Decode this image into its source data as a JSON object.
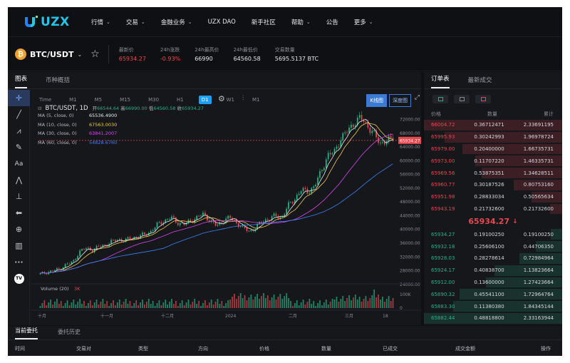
{
  "nav": {
    "logo_text": "UZX",
    "items": [
      {
        "label": "行情",
        "chevron": true
      },
      {
        "label": "交易",
        "chevron": true
      },
      {
        "label": "金融业务",
        "chevron": true
      },
      {
        "label": "UZX DAO",
        "chevron": false
      },
      {
        "label": "新手社区",
        "chevron": false
      },
      {
        "label": "帮助",
        "chevron": true
      },
      {
        "label": "公告",
        "chevron": false
      },
      {
        "label": "更多",
        "chevron": true
      }
    ]
  },
  "ticker": {
    "coin_symbol": "₿",
    "pair": "BTC/USDT",
    "stats": [
      {
        "label": "最新价",
        "value": "65934.27",
        "color": "red"
      },
      {
        "label": "24h涨跌",
        "value": "-0.93%",
        "color": "red"
      },
      {
        "label": "24h最高价",
        "value": "66990",
        "color": ""
      },
      {
        "label": "24h最低价",
        "value": "64560.58",
        "color": ""
      },
      {
        "label": "交易数量",
        "value": "5695.5137 BTC",
        "color": ""
      }
    ]
  },
  "chart_panel": {
    "tabs": [
      "图表",
      "币种概括"
    ],
    "intervals": [
      "Time",
      "M1",
      "M5",
      "M15",
      "M30",
      "H1",
      "D1",
      "W1",
      "M1"
    ],
    "active_interval": "D1",
    "modes": [
      "K线图",
      "深度图"
    ],
    "title": "BTC/USDT, 1D",
    "ohlc": {
      "open_label": "开",
      "open": "66544.64",
      "high_label": "高",
      "high": "66990.00",
      "low_label": "低",
      "low": "64560.58",
      "close_label": "收",
      "close": "65934.27"
    },
    "ma_lines": [
      {
        "label": "MA (5, close, 0)",
        "value": "65536.4900",
        "color": "#e8e8e8"
      },
      {
        "label": "MA (10, close, 0)",
        "value": "67563.0030",
        "color": "#f2c94c"
      },
      {
        "label": "MA (30, close, 0)",
        "value": "63841.2007",
        "color": "#d946ef"
      },
      {
        "label": "MA (60, close, 0)",
        "value": "54828.6760",
        "color": "#3b82f6"
      }
    ],
    "volume_label": "Volume (20)",
    "volume_value": "3K",
    "price_label": "65934.27",
    "tools": [
      "crosshair-tool-icon",
      "line-tool-icon",
      "fib-tool-icon",
      "brush-tool-icon",
      "text-tool-icon",
      "pattern-tool-icon",
      "measure-tool-icon",
      "back-arrow-icon",
      "zoom-tool-icon",
      "ruler-tool-icon",
      "more-tools-icon",
      "tradingview-logo"
    ]
  },
  "chart_data": {
    "type": "candlestick",
    "title": "BTC/USDT, 1D",
    "y_axis_ticks": [
      72000,
      68000,
      64000,
      60000,
      56000,
      52000,
      48000,
      44000,
      40000,
      36000,
      32000,
      28000,
      24000
    ],
    "y_axis_extra": [
      "66000.00"
    ],
    "x_axis_ticks": [
      "十月",
      "十一月",
      "十二月",
      "2024",
      "二月",
      "三月",
      "18"
    ],
    "volume_ticks": [
      "100K",
      "0"
    ],
    "close_approx": [
      27000,
      27500,
      28000,
      28500,
      29800,
      30500,
      33500,
      34500,
      34000,
      35000,
      35500,
      36500,
      37000,
      36800,
      37500,
      38000,
      38500,
      39500,
      41500,
      42500,
      43500,
      42000,
      41500,
      42500,
      43500,
      44500,
      42500,
      41000,
      42500,
      43500,
      42000,
      40500,
      39500,
      40500,
      42500,
      43000,
      44000,
      43500,
      47000,
      49000,
      51500,
      51000,
      52500,
      57000,
      61500,
      62500,
      66500,
      68500,
      71000,
      72500,
      70500,
      68000,
      65000,
      66000,
      65934
    ],
    "last_price": 65934.27
  },
  "orderbook": {
    "tabs": [
      "订单表",
      "最新成交"
    ],
    "headers": [
      "价格",
      "数量",
      "累计"
    ],
    "asks": [
      {
        "price": "66004.72",
        "qty": "0.36712471",
        "total": "2.33691195",
        "depth": 1.0
      },
      {
        "price": "65995.93",
        "qty": "0.30242993",
        "total": "1.96978724",
        "depth": 0.85
      },
      {
        "price": "65979.00",
        "qty": "0.20400000",
        "total": "1.66735731",
        "depth": 0.72
      },
      {
        "price": "65973.00",
        "qty": "0.11707220",
        "total": "1.46335731",
        "depth": 0.63
      },
      {
        "price": "65969.56",
        "qty": "0.53875351",
        "total": "1.34628511",
        "depth": 0.58
      },
      {
        "price": "65960.77",
        "qty": "0.30187526",
        "total": "0.80753160",
        "depth": 0.35
      },
      {
        "price": "65951.98",
        "qty": "0.28833034",
        "total": "0.50565634",
        "depth": 0.22
      },
      {
        "price": "65943.19",
        "qty": "0.21732600",
        "total": "0.21732600",
        "depth": 0.09
      }
    ],
    "mid_price": "65934.27",
    "mid_arrow": "↓",
    "bids": [
      {
        "price": "65934.27",
        "qty": "0.19100250",
        "total": "0.19100250",
        "depth": 0.08
      },
      {
        "price": "65932.18",
        "qty": "0.25606100",
        "total": "0.44706350",
        "depth": 0.19
      },
      {
        "price": "65928.03",
        "qty": "0.28278614",
        "total": "0.72984964",
        "depth": 0.31
      },
      {
        "price": "65924.17",
        "qty": "0.40838700",
        "total": "1.13823664",
        "depth": 0.49
      },
      {
        "price": "65912.00",
        "qty": "0.13600000",
        "total": "1.27423664",
        "depth": 0.55
      },
      {
        "price": "65890.32",
        "qty": "0.45541100",
        "total": "1.72964764",
        "depth": 0.74
      },
      {
        "price": "65883.30",
        "qty": "0.11380380",
        "total": "1.84345144",
        "depth": 0.79
      },
      {
        "price": "65882.44",
        "qty": "0.48818800",
        "total": "2.33163944",
        "depth": 1.0
      }
    ]
  },
  "bottom": {
    "tabs": [
      "当前委托",
      "委托历史"
    ],
    "columns": [
      "时间",
      "交易对",
      "类型",
      "方向",
      "价格",
      "数量",
      "已成交",
      "成交金额",
      "操作"
    ]
  },
  "colors": {
    "up": "#27b383",
    "down": "#e5484d",
    "accent": "#1ba0ff"
  }
}
